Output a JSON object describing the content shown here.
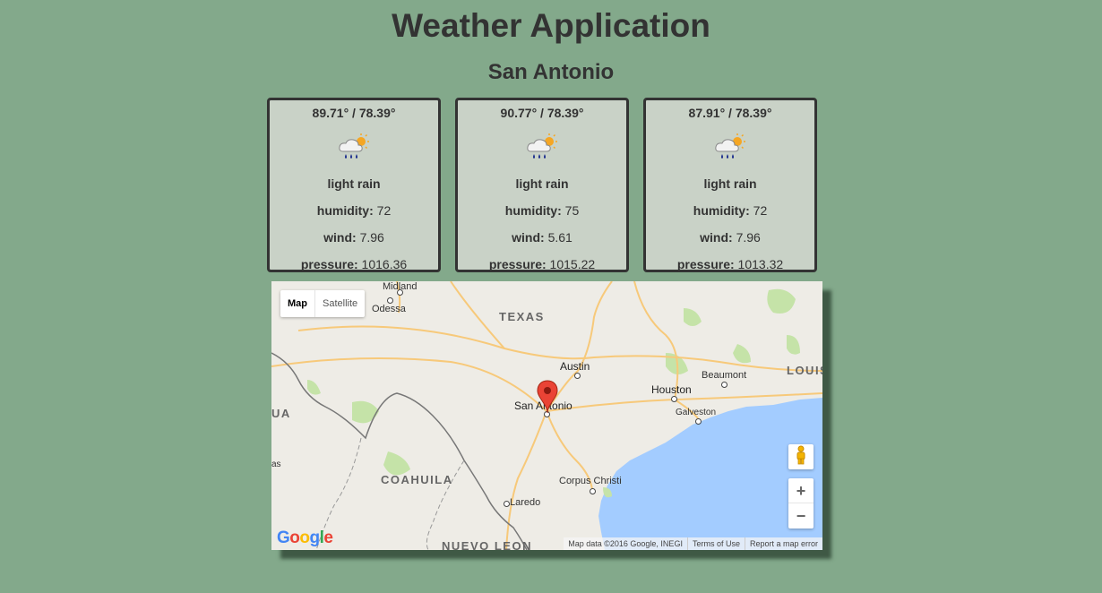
{
  "app_title": "Weather Application",
  "city": "San Antonio",
  "forecast": [
    {
      "temps": "89.71° / 78.39°",
      "description": "light rain",
      "humidity_label": "humidity:",
      "humidity": "72",
      "wind_label": "wind:",
      "wind": "7.96",
      "pressure_label": "pressure:",
      "pressure": "1016.36",
      "icon": "light-rain-icon"
    },
    {
      "temps": "90.77° / 78.39°",
      "description": "light rain",
      "humidity_label": "humidity:",
      "humidity": "75",
      "wind_label": "wind:",
      "wind": "5.61",
      "pressure_label": "pressure:",
      "pressure": "1015.22",
      "icon": "light-rain-icon"
    },
    {
      "temps": "87.91° / 78.39°",
      "description": "light rain",
      "humidity_label": "humidity:",
      "humidity": "72",
      "wind_label": "wind:",
      "wind": "7.96",
      "pressure_label": "pressure:",
      "pressure": "1013.32",
      "icon": "light-rain-icon"
    }
  ],
  "map": {
    "type_map": "Map",
    "type_satellite": "Satellite",
    "zoom_in": "+",
    "zoom_out": "−",
    "logo": "Google",
    "attribution": "Map data ©2016 Google, INEGI",
    "terms": "Terms of Use",
    "report": "Report a map error",
    "labels": {
      "midland": "Midland",
      "odessa": "Odessa",
      "texas": "TEXAS",
      "austin": "Austin",
      "beaumont": "Beaumont",
      "louis": "LOUIS",
      "houston": "Houston",
      "san_antonio": "San Antonio",
      "galveston": "Galveston",
      "ua": "UA",
      "as": "as",
      "coahuila": "COAHUILA",
      "corpus_christi": "Corpus Christi",
      "laredo": "Laredo",
      "nuevo_leon": "NUEVO LEON"
    }
  }
}
